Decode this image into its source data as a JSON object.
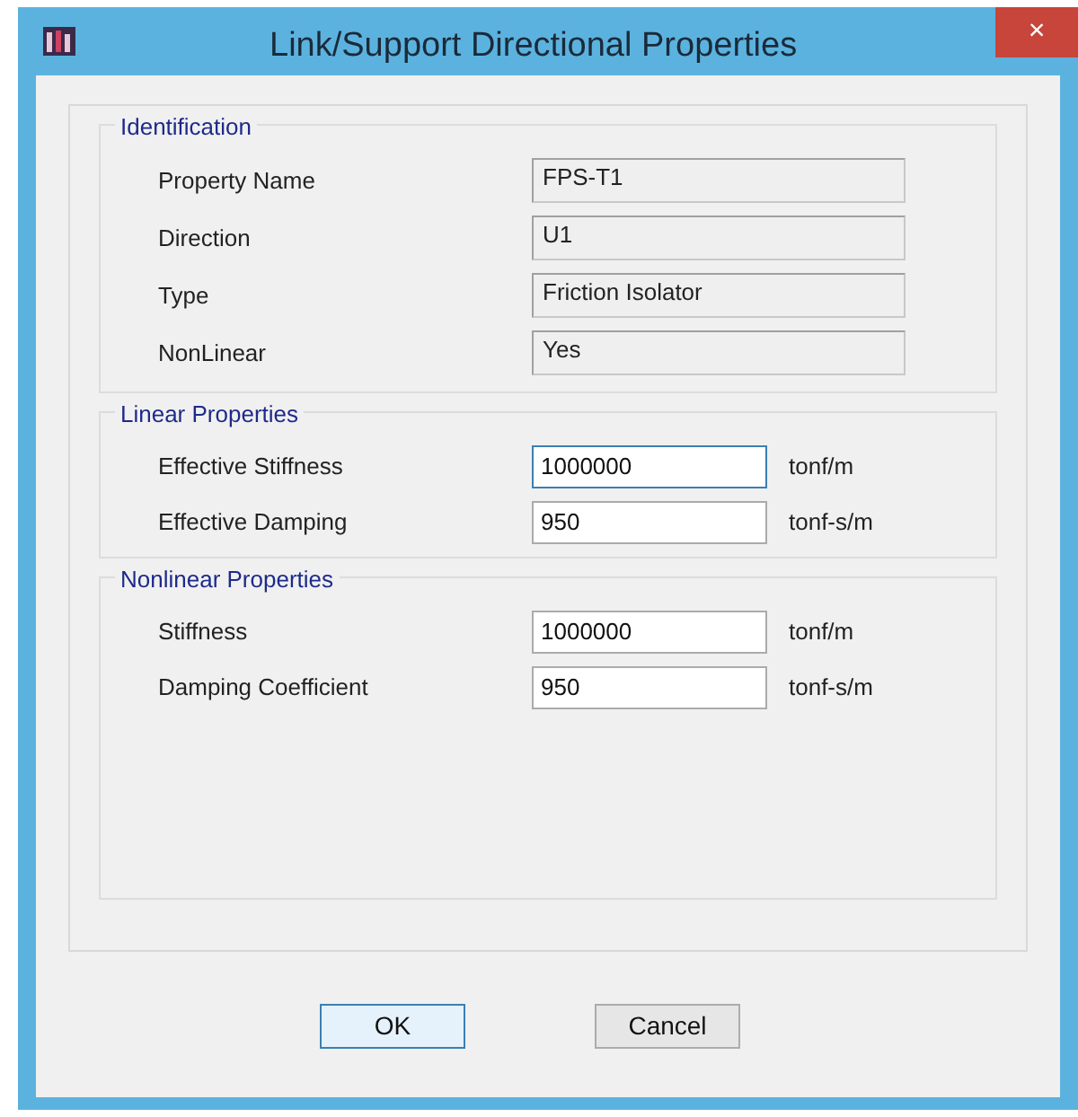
{
  "window": {
    "title": "Link/Support Directional Properties",
    "close": "×"
  },
  "groups": [
    {
      "title": "Identification",
      "rows": [
        {
          "label": "Property Name",
          "value": "FPS-T1",
          "kind": "readonly",
          "focused": false
        },
        {
          "label": "Direction",
          "value": "U1",
          "kind": "readonly",
          "focused": false
        },
        {
          "label": "Type",
          "value": "Friction Isolator",
          "kind": "readonly",
          "focused": false
        },
        {
          "label": "NonLinear",
          "value": "Yes",
          "kind": "readonly",
          "focused": false
        }
      ]
    },
    {
      "title": "Linear Properties",
      "rows": [
        {
          "label": "Effective Stiffness",
          "value": "1000000",
          "unit": "tonf/m",
          "kind": "editable",
          "focused": true
        },
        {
          "label": "Effective Damping",
          "value": "950",
          "unit": "tonf-s/m",
          "kind": "editable",
          "focused": false
        }
      ]
    },
    {
      "title": "Nonlinear Properties",
      "rows": [
        {
          "label": "Stiffness",
          "value": "1000000",
          "unit": "tonf/m",
          "kind": "editable",
          "focused": false
        },
        {
          "label": "Damping Coefficient",
          "value": "950",
          "unit": "tonf-s/m",
          "kind": "editable",
          "focused": false
        }
      ]
    }
  ],
  "buttons": [
    {
      "label": "OK",
      "default": true
    },
    {
      "label": "Cancel",
      "default": false
    }
  ]
}
